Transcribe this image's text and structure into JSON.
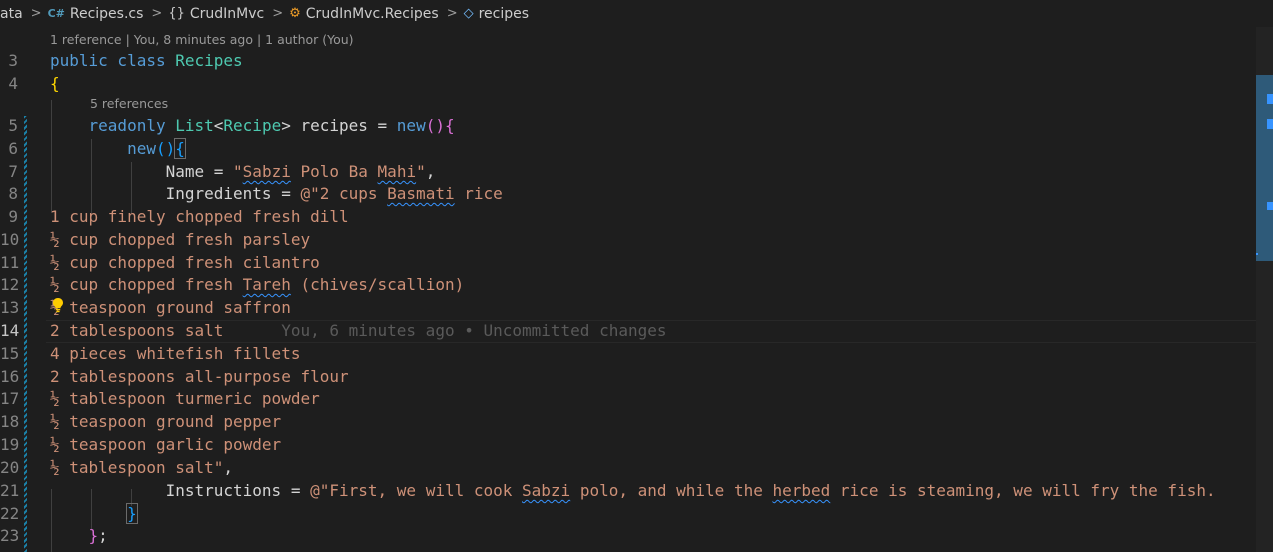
{
  "breadcrumb": {
    "segments": [
      {
        "label": "ata",
        "icon": ""
      },
      {
        "label": "Recipes.cs",
        "icon": "csharp-file-icon",
        "icon_glyph": "C#"
      },
      {
        "label": "CrudInMvc",
        "icon": "namespace-icon",
        "icon_glyph": "{}"
      },
      {
        "label": "CrudInMvc.Recipes",
        "icon": "class-icon",
        "icon_glyph": "⚙"
      },
      {
        "label": "recipes",
        "icon": "field-icon",
        "icon_glyph": "◇"
      }
    ]
  },
  "codelens": {
    "class_lens": "1 reference | You, 8 minutes ago | 1 author (You)",
    "field_lens": "5 references"
  },
  "line_numbers": [
    "3",
    "4",
    "5",
    "6",
    "7",
    "8",
    "9",
    "10",
    "11",
    "12",
    "13",
    "14",
    "15",
    "16",
    "17",
    "18",
    "19",
    "20",
    "21",
    "22",
    "23"
  ],
  "code": {
    "l3_kw": "public class ",
    "l3_type": "Recipes",
    "l4_brace": "{",
    "l5_kw": "readonly ",
    "l5_type1": "List",
    "l5_lt": "<",
    "l5_type2": "Recipe",
    "l5_gt": "> recipes = ",
    "l5_new": "new",
    "l5_paren": "()",
    "l5_brace": "{",
    "l6_new": "new",
    "l6_paren": "()",
    "l6_brace": "{",
    "l7_prop": "Name = ",
    "l7_str_a": "\"",
    "l7_str_sabzi": "Sabzi",
    "l7_str_b": " Polo Ba ",
    "l7_str_mahi": "Mahi",
    "l7_str_c": "\"",
    "l7_comma": ",",
    "l8_prop": "Ingredients = ",
    "l8_str_a": "@\"2 cups ",
    "l8_str_basmati": "Basmati",
    "l8_str_b": " rice",
    "l9": "1 cup finely chopped fresh dill",
    "l10": "½ cup chopped fresh parsley",
    "l11": "½ cup chopped fresh cilantro",
    "l12_a": "½ cup chopped fresh ",
    "l12_tareh": "Tareh",
    "l12_b": " (chives/scallion)",
    "l13": "½ teaspoon ground saffron",
    "l14": "2 tablespoons salt",
    "l14_blame": "You, 6 minutes ago • Uncommitted changes",
    "l15": "4 pieces whitefish fillets",
    "l16": "2 tablespoons all-purpose flour",
    "l17": "½ tablespoon turmeric powder",
    "l18": "½ teaspoon ground pepper",
    "l19": "½ teaspoon garlic powder",
    "l20_str": "½ tablespoon salt\"",
    "l20_comma": ",",
    "l21_prop": "Instructions = ",
    "l21_str_a": "@\"First, we will cook ",
    "l21_str_sabzi": "Sabzi",
    "l21_str_b": " polo, and while the ",
    "l21_str_herbed": "herbed",
    "l21_str_c": " rice is steaming, we will fry the fish.",
    "l22_brace": "}",
    "l23_brace": "}",
    "l23_semi": ";"
  },
  "colors": {
    "background": "#1e1e1e",
    "keyword": "#569cd6",
    "type": "#4ec9b0",
    "string": "#ce9178",
    "bracket_gold": "#ffd700",
    "bracket_purple": "#da70d6",
    "bracket_blue": "#179fff"
  }
}
